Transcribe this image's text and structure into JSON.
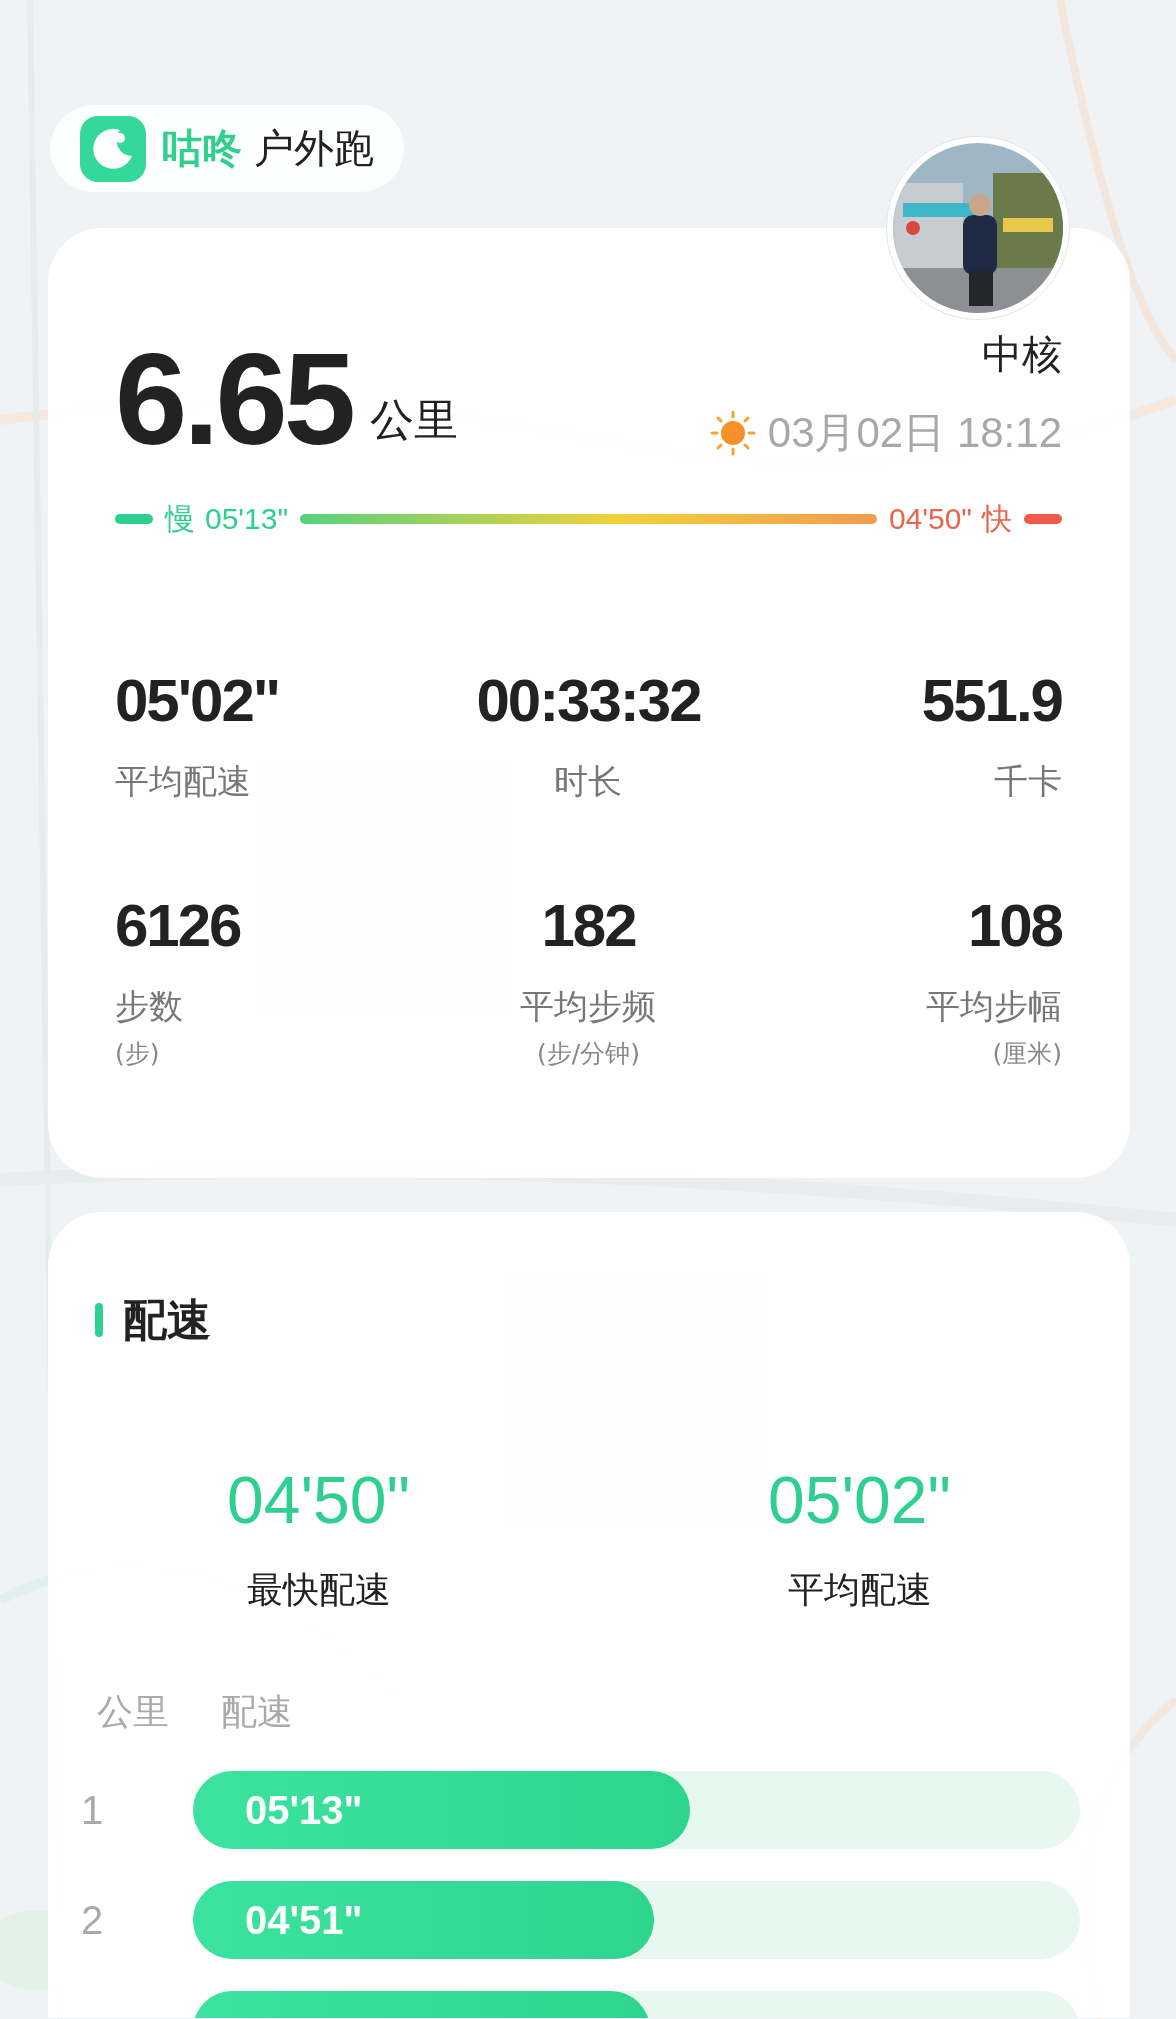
{
  "app": {
    "brand": "咕咚",
    "activity": "户外跑"
  },
  "summary": {
    "distance": "6.65",
    "unit": "公里",
    "location": "中核",
    "datetime": "03月02日 18:12",
    "pace_range": {
      "slow_label": "慢",
      "slow": "05'13\"",
      "fast": "04'50\"",
      "fast_label": "快"
    },
    "stats": [
      {
        "value": "05'02\"",
        "label": "平均配速"
      },
      {
        "value": "00:33:32",
        "label": "时长"
      },
      {
        "value": "551.9",
        "label": "千卡"
      },
      {
        "value": "6126",
        "label": "步数",
        "unit": "(步)"
      },
      {
        "value": "182",
        "label": "平均步频",
        "unit": "(步/分钟)"
      },
      {
        "value": "108",
        "label": "平均步幅",
        "unit": "(厘米)"
      }
    ]
  },
  "pace": {
    "title": "配速",
    "highlights": [
      {
        "value": "04'50\"",
        "label": "最快配速"
      },
      {
        "value": "05'02\"",
        "label": "平均配速"
      }
    ],
    "columns": [
      "公里",
      "配速"
    ],
    "splits": [
      {
        "km": "1",
        "pace": "05'13\"",
        "level": 0.56
      },
      {
        "km": "2",
        "pace": "04'51\"",
        "level": 0.52
      },
      {
        "level": 0.515
      }
    ]
  }
}
